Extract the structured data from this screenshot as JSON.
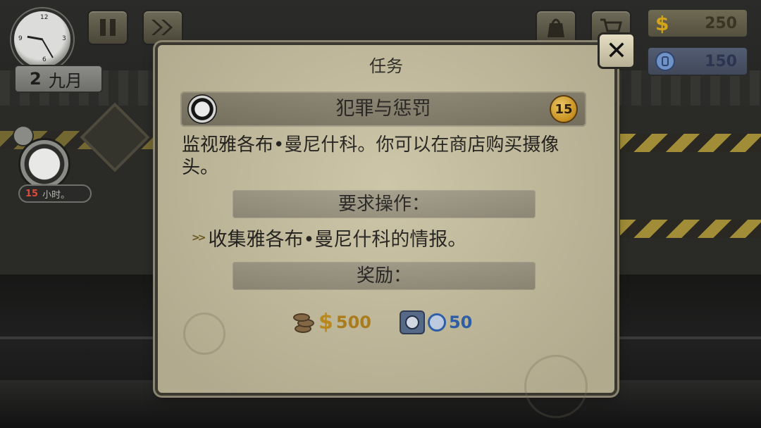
{
  "hud": {
    "clock_label": "clock",
    "day": "2",
    "month": "九月",
    "money": "250",
    "reputation": "150",
    "task_hours": "15",
    "task_hours_unit": "小时。"
  },
  "dialog": {
    "title": "任务",
    "quest_name": "犯罪与惩罚",
    "difficulty": "15",
    "description": "监视雅各布•曼尼什科。你可以在商店购买摄像头。",
    "required_label": "要求操作：",
    "required_item": "收集雅各布•曼尼什科的情报。",
    "reward_label": "奖励：",
    "reward_money": "500",
    "reward_money_symbol": "$",
    "reward_reputation": "50",
    "close_symbol": "✕"
  },
  "colors": {
    "panel": "#c9c1a1",
    "gold": "#c48e16",
    "reputation_blue": "#2a5fae"
  },
  "icons": [
    "clock-icon",
    "pause-icon",
    "fast-forward-icon",
    "inventory-bag-icon",
    "shop-cart-icon",
    "dollar-icon",
    "reputation-icon",
    "close-icon",
    "police-badge-icon",
    "coins-icon",
    "shield-badge-icon"
  ]
}
